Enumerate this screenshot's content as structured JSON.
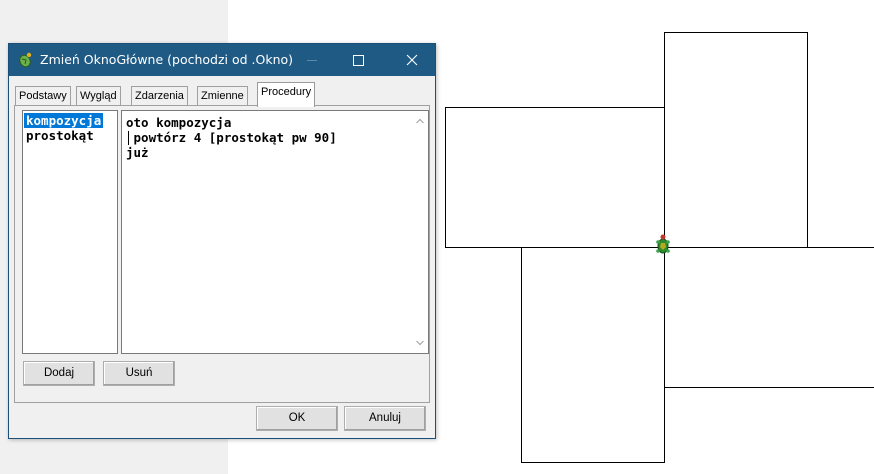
{
  "dialog": {
    "title": "Zmień OknoGłówne (pochodzi od .Okno)",
    "tabs": [
      {
        "label": "Podstawy",
        "active": false
      },
      {
        "label": "Wygląd",
        "active": false
      },
      {
        "label": "Zdarzenia",
        "active": false
      },
      {
        "label": "Zmienne",
        "active": false
      },
      {
        "label": "Procedury",
        "active": true
      }
    ],
    "procedures": [
      {
        "name": "kompozycja",
        "selected": true
      },
      {
        "name": "prostokąt",
        "selected": false
      }
    ],
    "code_lines": [
      "oto kompozycja",
      " powtórz 4 [prostokąt pw 90]",
      "już"
    ],
    "buttons": {
      "add": "Dodaj",
      "remove": "Usuń",
      "ok": "OK",
      "cancel": "Anuluj"
    }
  },
  "colors": {
    "titlebar": "#1f5a85",
    "selection": "#0078d7",
    "turtle": "#2e8b2e"
  }
}
